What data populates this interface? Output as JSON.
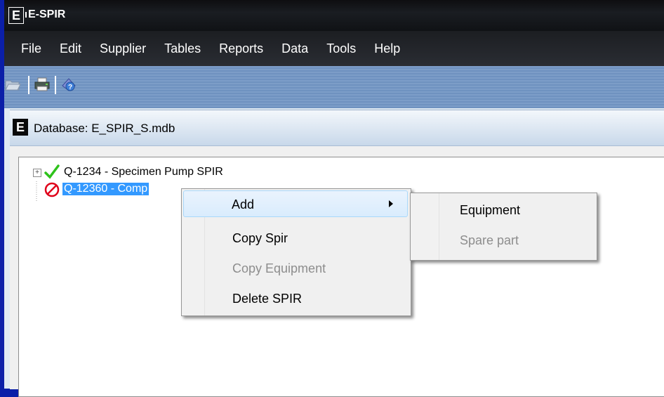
{
  "window": {
    "title": "E-SPIR"
  },
  "menubar": {
    "items": [
      "File",
      "Edit",
      "Supplier",
      "Tables",
      "Reports",
      "Data",
      "Tools",
      "Help"
    ]
  },
  "toolbar": {
    "buttons": [
      "open-folder-icon",
      "print-icon",
      "help-icon"
    ]
  },
  "document": {
    "title": "Database: E_SPIR_S.mdb"
  },
  "tree": {
    "items": [
      {
        "label": "Q-1234 - Specimen Pump SPIR",
        "status_icon": "green-check-icon"
      },
      {
        "label": "Q-12360 - Comp",
        "status_icon": "red-prohibited-icon"
      }
    ]
  },
  "context_menu": {
    "items": [
      {
        "label": "Add",
        "has_submenu": true,
        "highlighted": true
      },
      {
        "label": "Copy Spir",
        "disabled": false
      },
      {
        "label": "Copy Equipment",
        "disabled": true
      },
      {
        "label": "Delete SPIR",
        "disabled": false
      }
    ]
  },
  "submenu": {
    "items": [
      {
        "label": "Equipment",
        "disabled": false
      },
      {
        "label": "Spare part",
        "disabled": true
      }
    ]
  },
  "colors": {
    "selection": "#3399ff",
    "desktop": "#0b1fa8",
    "check": "#2ec21b",
    "prohibited": "#e0001a"
  }
}
